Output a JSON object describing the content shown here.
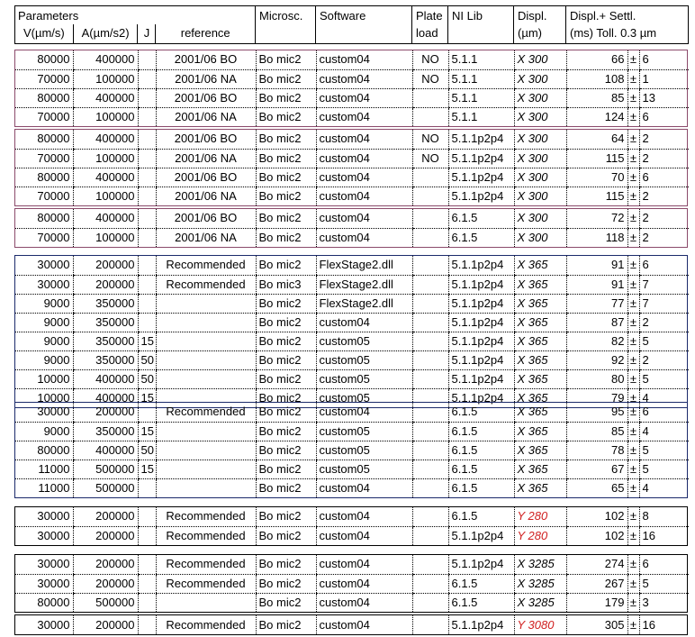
{
  "header": {
    "parameters_group": "Parameters",
    "col_v": "V(µm/s)",
    "col_a": "A(µm/s2)",
    "col_j": "J",
    "col_ref": "reference",
    "col_microsc": "Microsc.",
    "col_software": "Software",
    "col_plate_l1": "Plate",
    "col_plate_l2": "load",
    "col_nilib": "NI Lib",
    "col_displ_l1": "Displ.",
    "col_displ_l2": "(µm)",
    "col_settl_l1": "Displ.+ Settl.",
    "col_settl_l2": "(ms) Toll. 0.3 µm"
  },
  "colors": {
    "purple_border": "#8b4a6b",
    "navy_border": "#1b2a6b",
    "black_border": "#000000",
    "red_text": "#d02020"
  },
  "plus_minus": "±",
  "blocks": [
    {
      "border": "purple",
      "rows": [
        {
          "v": "80000",
          "a": "400000",
          "j": "",
          "ref": "2001/06 BO",
          "mic": "Bo mic2",
          "sw": "custom04",
          "plate": "NO",
          "ni": "5.1.1",
          "displ": "X 300",
          "num": "66",
          "tol": "6"
        },
        {
          "v": "70000",
          "a": "100000",
          "j": "",
          "ref": "2001/06 NA",
          "mic": "Bo mic2",
          "sw": "custom04",
          "plate": "NO",
          "ni": "5.1.1",
          "displ": "X 300",
          "num": "108",
          "tol": "1"
        },
        {
          "v": "80000",
          "a": "400000",
          "j": "",
          "ref": "2001/06 BO",
          "mic": "Bo mic2",
          "sw": "custom04",
          "plate": "",
          "ni": "5.1.1",
          "displ": "X 300",
          "num": "85",
          "tol": "13"
        },
        {
          "v": "70000",
          "a": "100000",
          "j": "",
          "ref": "2001/06 NA",
          "mic": "Bo mic2",
          "sw": "custom04",
          "plate": "",
          "ni": "5.1.1",
          "displ": "X 300",
          "num": "124",
          "tol": "6"
        }
      ]
    },
    {
      "border": "purple",
      "rows": [
        {
          "v": "80000",
          "a": "400000",
          "j": "",
          "ref": "2001/06 BO",
          "mic": "Bo mic2",
          "sw": "custom04",
          "plate": "NO",
          "ni": "5.1.1p2p4",
          "displ": "X 300",
          "num": "64",
          "tol": "2"
        },
        {
          "v": "70000",
          "a": "100000",
          "j": "",
          "ref": "2001/06 NA",
          "mic": "Bo mic2",
          "sw": "custom04",
          "plate": "NO",
          "ni": "5.1.1p2p4",
          "displ": "X 300",
          "num": "115",
          "tol": "2"
        },
        {
          "v": "80000",
          "a": "400000",
          "j": "",
          "ref": "2001/06 BO",
          "mic": "Bo mic2",
          "sw": "custom04",
          "plate": "",
          "ni": "5.1.1p2p4",
          "displ": "X 300",
          "num": "70",
          "tol": "6"
        },
        {
          "v": "70000",
          "a": "100000",
          "j": "",
          "ref": "2001/06 NA",
          "mic": "Bo mic2",
          "sw": "custom04",
          "plate": "",
          "ni": "5.1.1p2p4",
          "displ": "X 300",
          "num": "115",
          "tol": "2"
        }
      ]
    },
    {
      "border": "purple",
      "rows": [
        {
          "v": "80000",
          "a": "400000",
          "j": "",
          "ref": "2001/06 BO",
          "mic": "Bo mic2",
          "sw": "custom04",
          "plate": "",
          "ni": "6.1.5",
          "displ": "X 300",
          "num": "72",
          "tol": "2"
        },
        {
          "v": "70000",
          "a": "100000",
          "j": "",
          "ref": "2001/06 NA",
          "mic": "Bo mic2",
          "sw": "custom04",
          "plate": "",
          "ni": "6.1.5",
          "displ": "X 300",
          "num": "118",
          "tol": "2"
        }
      ]
    },
    {
      "border": "navy",
      "rows": [
        {
          "v": "30000",
          "a": "200000",
          "j": "",
          "ref": "Recommended",
          "mic": "Bo mic2",
          "sw": "FlexStage2.dll",
          "plate": "",
          "ni": "5.1.1p2p4",
          "displ": "X 365",
          "num": "91",
          "tol": "6"
        },
        {
          "v": "30000",
          "a": "200000",
          "j": "",
          "ref": "Recommended",
          "mic": "Bo mic3",
          "sw": "FlexStage2.dll",
          "plate": "",
          "ni": "5.1.1p2p4",
          "displ": "X 365",
          "num": "91",
          "tol": "7"
        },
        {
          "v": "9000",
          "a": "350000",
          "j": "",
          "ref": "",
          "mic": "Bo mic2",
          "sw": "FlexStage2.dll",
          "plate": "",
          "ni": "5.1.1p2p4",
          "displ": "X 365",
          "num": "77",
          "tol": "7"
        },
        {
          "v": "9000",
          "a": "350000",
          "j": "",
          "ref": "",
          "mic": "Bo mic2",
          "sw": "custom04",
          "plate": "",
          "ni": "5.1.1p2p4",
          "displ": "X 365",
          "num": "87",
          "tol": "2"
        },
        {
          "v": "9000",
          "a": "350000",
          "j": "15",
          "ref": "",
          "mic": "Bo mic2",
          "sw": "custom05",
          "plate": "",
          "ni": "5.1.1p2p4",
          "displ": "X 365",
          "num": "82",
          "tol": "5"
        },
        {
          "v": "9000",
          "a": "350000",
          "j": "50",
          "ref": "",
          "mic": "Bo mic2",
          "sw": "custom05",
          "plate": "",
          "ni": "5.1.1p2p4",
          "displ": "X 365",
          "num": "92",
          "tol": "2"
        },
        {
          "v": "10000",
          "a": "400000",
          "j": "50",
          "ref": "",
          "mic": "Bo mic2",
          "sw": "custom05",
          "plate": "",
          "ni": "5.1.1p2p4",
          "displ": "X 365",
          "num": "80",
          "tol": "5"
        },
        {
          "v": "10000",
          "a": "400000",
          "j": "15",
          "ref": "",
          "mic": "Bo mic2",
          "sw": "custom05",
          "plate": "",
          "ni": "5.1.1p2p4",
          "displ": "X 365",
          "num": "79",
          "tol": "4"
        }
      ]
    },
    {
      "border": "navy",
      "rows": [
        {
          "v": "30000",
          "a": "200000",
          "j": "",
          "ref": "Recommended",
          "mic": "Bo mic2",
          "sw": "custom04",
          "plate": "",
          "ni": "6.1.5",
          "displ": "X 365",
          "num": "95",
          "tol": "6"
        },
        {
          "v": "9000",
          "a": "350000",
          "j": "15",
          "ref": "",
          "mic": "Bo mic2",
          "sw": "custom05",
          "plate": "",
          "ni": "6.1.5",
          "displ": "X 365",
          "num": "85",
          "tol": "4"
        },
        {
          "v": "80000",
          "a": "400000",
          "j": "50",
          "ref": "",
          "mic": "Bo mic2",
          "sw": "custom05",
          "plate": "",
          "ni": "6.1.5",
          "displ": "X 365",
          "num": "78",
          "tol": "5"
        },
        {
          "v": "11000",
          "a": "500000",
          "j": "15",
          "ref": "",
          "mic": "Bo mic2",
          "sw": "custom05",
          "plate": "",
          "ni": "6.1.5",
          "displ": "X 365",
          "num": "67",
          "tol": "5"
        },
        {
          "v": "11000",
          "a": "500000",
          "j": "",
          "ref": "",
          "mic": "Bo mic2",
          "sw": "custom04",
          "plate": "",
          "ni": "6.1.5",
          "displ": "X 365",
          "num": "65",
          "tol": "4"
        }
      ]
    },
    {
      "border": "black",
      "rows": [
        {
          "v": "30000",
          "a": "200000",
          "j": "",
          "ref": "Recommended",
          "mic": "Bo mic2",
          "sw": "custom04",
          "plate": "",
          "ni": "6.1.5",
          "displ": "Y 280",
          "displ_red": true,
          "num": "102",
          "tol": "8"
        },
        {
          "v": "30000",
          "a": "200000",
          "j": "",
          "ref": "Recommended",
          "mic": "Bo mic2",
          "sw": "custom04",
          "plate": "",
          "ni": "5.1.1p2p4",
          "displ": "Y 280",
          "displ_red": true,
          "num": "102",
          "tol": "16"
        }
      ]
    },
    {
      "border": "black",
      "rows": [
        {
          "v": "30000",
          "a": "200000",
          "j": "",
          "ref": "Recommended",
          "mic": "Bo mic2",
          "sw": "custom04",
          "plate": "",
          "ni": "5.1.1p2p4",
          "displ": "X 3285",
          "num": "274",
          "tol": "6"
        },
        {
          "v": "30000",
          "a": "200000",
          "j": "",
          "ref": "Recommended",
          "mic": "Bo mic2",
          "sw": "custom04",
          "plate": "",
          "ni": "6.1.5",
          "displ": "X 3285",
          "num": "267",
          "tol": "5"
        },
        {
          "v": "80000",
          "a": "500000",
          "j": "",
          "ref": "",
          "mic": "Bo mic2",
          "sw": "custom04",
          "plate": "",
          "ni": "6.1.5",
          "displ": "X 3285",
          "num": "179",
          "tol": "3"
        }
      ]
    },
    {
      "border": "black",
      "rows": [
        {
          "v": "30000",
          "a": "200000",
          "j": "",
          "ref": "Recommended",
          "mic": "Bo mic2",
          "sw": "custom04",
          "plate": "",
          "ni": "5.1.1p2p4",
          "displ": "Y 3080",
          "displ_red": true,
          "num": "305",
          "tol": "16"
        }
      ]
    }
  ]
}
